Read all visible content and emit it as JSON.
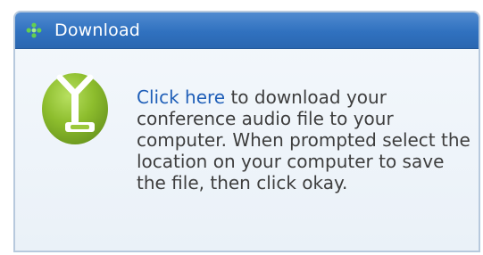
{
  "header": {
    "title": "Download",
    "icon": "move-cross-icon"
  },
  "content": {
    "graphic_icon": "download-arrow-icon",
    "link_text": "Click here",
    "message_text": " to download your conference audio file to your computer. When prompted select the location on your computer to save the file, then click okay."
  },
  "colors": {
    "header_blue": "#3071bf",
    "panel_bg": "#eef4fa",
    "icon_green": "#8bbf2f",
    "link_blue": "#1f5fb8",
    "text": "#3e3e3e"
  }
}
